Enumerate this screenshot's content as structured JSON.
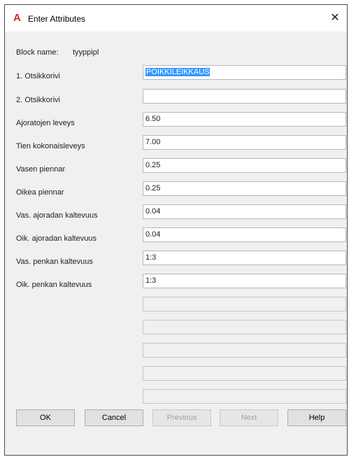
{
  "window": {
    "title": "Enter Attributes",
    "app_icon_glyph": "A",
    "close_glyph": "✕",
    "icon_color": "#e2231a"
  },
  "block": {
    "label": "Block name:",
    "value": "tyyppipl"
  },
  "attributes": [
    {
      "label": "1. Otsikkorivi",
      "value": "POIKKILEIKKAUS",
      "selected": true
    },
    {
      "label": "2. Otsikkorivi",
      "value": ""
    },
    {
      "label": "Ajoratojen leveys",
      "value": "6.50"
    },
    {
      "label": "Tien kokonaisleveys",
      "value": "7.00"
    },
    {
      "label": "Vasen piennar",
      "value": "0.25"
    },
    {
      "label": "Oikea piennar",
      "value": "0.25"
    },
    {
      "label": "Vas. ajoradan kaltevuus",
      "value": "0.04"
    },
    {
      "label": "Oik. ajoradan kaltevuus",
      "value": "0.04"
    },
    {
      "label": "Vas. penkan kaltevuus",
      "value": "1:3"
    },
    {
      "label": "Oik. penkan kaltevuus",
      "value": "1:3"
    }
  ],
  "buttons": {
    "ok": "OK",
    "cancel": "Cancel",
    "previous": "Previous",
    "next": "Next",
    "help": "Help"
  },
  "colors": {
    "selection": "#3399ff",
    "dialog_bg": "#f0f0f0"
  }
}
